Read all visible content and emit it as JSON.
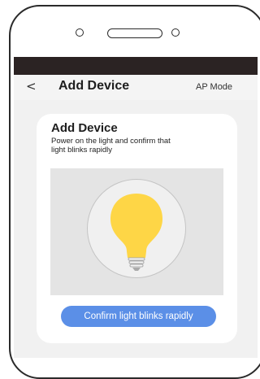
{
  "nav": {
    "back_glyph": "<",
    "title": "Add Device",
    "mode_link": "AP Mode"
  },
  "card": {
    "title": "Add Device",
    "instruction": "Power on the light and confirm that light blinks rapidly",
    "illustration_icon": "light-bulb-icon",
    "confirm_button": "Confirm light blinks rapidly"
  },
  "colors": {
    "status_bar": "#2b2323",
    "screen_bg": "#f1f1f1",
    "accent_button": "#5b8fe7",
    "bulb_yellow": "#fed646"
  }
}
